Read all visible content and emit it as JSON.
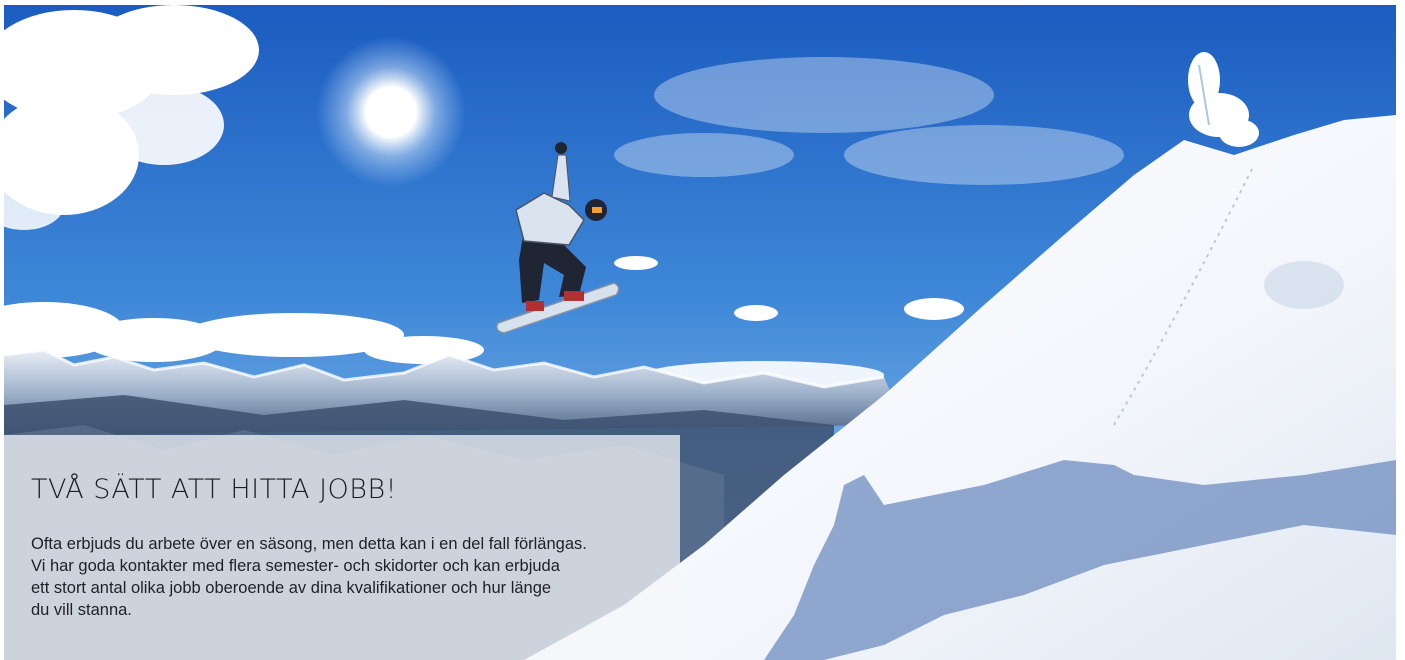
{
  "hero": {
    "image_subject": "snowboarder-jump"
  },
  "info_card": {
    "title": "TVÅ SÄTT ATT HITTA JOBB!",
    "body_lines": [
      "Ofta erbjuds du arbete över en säsong, men detta kan i en del fall förlängas.",
      "Vi har goda kontakter med flera semester- och skidorter och kan erbjuda",
      "ett stort antal olika jobb oberoende av dina kvalifikationer och hur länge",
      "du vill stanna."
    ]
  },
  "colors": {
    "sky_top": "#1a5fc4",
    "sky_bottom": "#8fc0ea",
    "snow": "#f4f7fb",
    "snow_shadow": "#6f8fbf",
    "card_bg": "#f5f7fa",
    "text": "#1b1f24"
  }
}
